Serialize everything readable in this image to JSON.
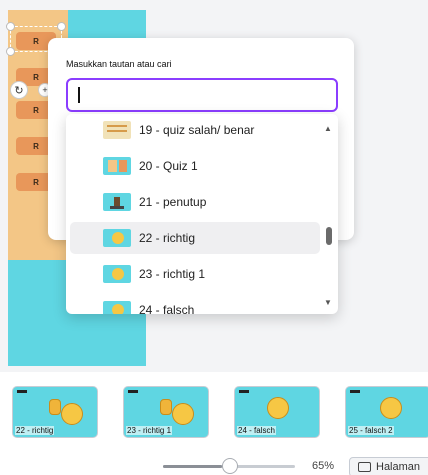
{
  "popup": {
    "label": "Masukkan tautan atau cari",
    "input_value": "",
    "input_placeholder": ""
  },
  "dropdown": {
    "items": [
      {
        "label": "19 - quiz salah/ benar",
        "thumb": "quiz-true-false-thumbnail",
        "active": false
      },
      {
        "label": "20 - Quiz 1",
        "thumb": "quiz-thumbnail",
        "active": false
      },
      {
        "label": "21 - penutup",
        "thumb": "closing-thumbnail",
        "active": false
      },
      {
        "label": "22 - richtig",
        "thumb": "richtig-thumbnail",
        "active": true
      },
      {
        "label": "23 - richtig 1",
        "thumb": "richtig-thumbnail",
        "active": false
      },
      {
        "label": "24 - falsch",
        "thumb": "falsch-thumbnail",
        "active": false
      }
    ],
    "scroll_position": 0.6
  },
  "canvas": {
    "buttons": [
      "R",
      "R",
      "R",
      "R",
      "R",
      "R"
    ]
  },
  "pages": [
    {
      "label": "22 - richtig",
      "icon": "thumbs-up-emoji-icon"
    },
    {
      "label": "23 - richtig 1",
      "icon": "thumbs-up-emoji-icon"
    },
    {
      "label": "24 - falsch",
      "icon": "sad-emoji-icon"
    },
    {
      "label": "25 - falsch 2",
      "icon": "sad-emoji-icon"
    }
  ],
  "footer": {
    "zoom_value": "65%",
    "zoom_level": 0.45,
    "pages_label": "Halaman"
  },
  "colors": {
    "accent": "#8b3dff",
    "slide_background": "#5fd6e2",
    "button_orange": "#e8975a"
  }
}
